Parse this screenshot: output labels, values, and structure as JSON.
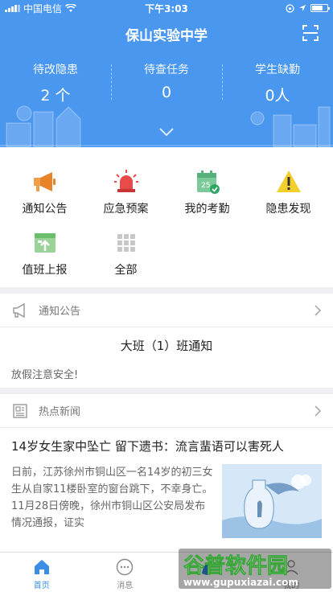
{
  "status_bar": {
    "carrier": "中国电信",
    "time": "下午3:03"
  },
  "header": {
    "title": "保山实验中学",
    "stats": [
      {
        "label": "待改隐患",
        "value": "2 个"
      },
      {
        "label": "待查任务",
        "value": "0"
      },
      {
        "label": "学生缺勤",
        "value": "0人"
      }
    ]
  },
  "quick_actions": [
    {
      "label": "通知公告",
      "icon": "megaphone-icon"
    },
    {
      "label": "应急预案",
      "icon": "alarm-light-icon"
    },
    {
      "label": "我的考勤",
      "icon": "calendar-check-icon"
    },
    {
      "label": "隐患发现",
      "icon": "warning-icon"
    },
    {
      "label": "值班上报",
      "icon": "duty-report-icon"
    },
    {
      "label": "全部",
      "icon": "grid-icon"
    }
  ],
  "notice": {
    "section_label": "通知公告",
    "title": "大班（1）班通知",
    "body": "放假注意安全!"
  },
  "news": {
    "section_label": "热点新闻",
    "title": "14岁女生家中坠亡 留下遗书：流言蜚语可以害死人",
    "excerpt": "日前，江苏徐州市铜山区一名14岁的初三女生从自家11楼卧室的窗台跳下，不幸身亡。11月28日傍晚，徐州市铜山区公安局发布情况通报，证实"
  },
  "tabbar": [
    {
      "label": "首页",
      "active": true
    },
    {
      "label": "消息",
      "active": false
    },
    {
      "label": "",
      "active": false
    },
    {
      "label": "我的",
      "active": false
    }
  ],
  "watermark": {
    "line1": "谷普软件园",
    "line2": "www.gupuxiazai.com"
  },
  "colors": {
    "header_blue": "#4a97f0",
    "accent": "#3a8ee6"
  }
}
